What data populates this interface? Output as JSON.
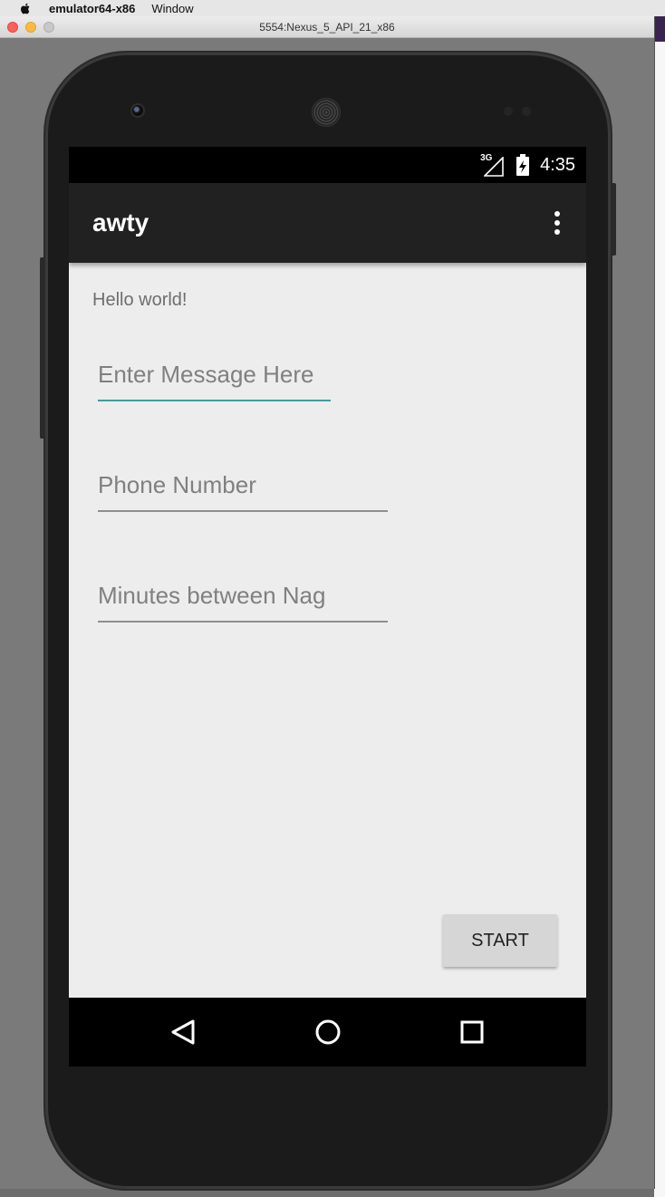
{
  "menubar": {
    "app_name": "emulator64-x86",
    "menu_window": "Window"
  },
  "emulator_window": {
    "title": "5554:Nexus_5_API_21_x86"
  },
  "statusbar": {
    "network": "3G",
    "time": "4:35"
  },
  "appbar": {
    "title": "awty",
    "overflow_icon": "more-vert-icon"
  },
  "content": {
    "hello_text": "Hello world!",
    "message_field": {
      "placeholder": "Enter Message Here",
      "value": ""
    },
    "phone_field": {
      "placeholder": "Phone Number",
      "value": ""
    },
    "minutes_field": {
      "placeholder": "Minutes between Nag",
      "value": ""
    },
    "start_button": "START"
  },
  "navbar": {
    "back_icon": "back-triangle-icon",
    "home_icon": "home-circle-icon",
    "recents_icon": "recents-square-icon"
  },
  "colors": {
    "accent": "#3f9e9a",
    "appbar": "#212121",
    "screen_bg": "#ededed"
  }
}
